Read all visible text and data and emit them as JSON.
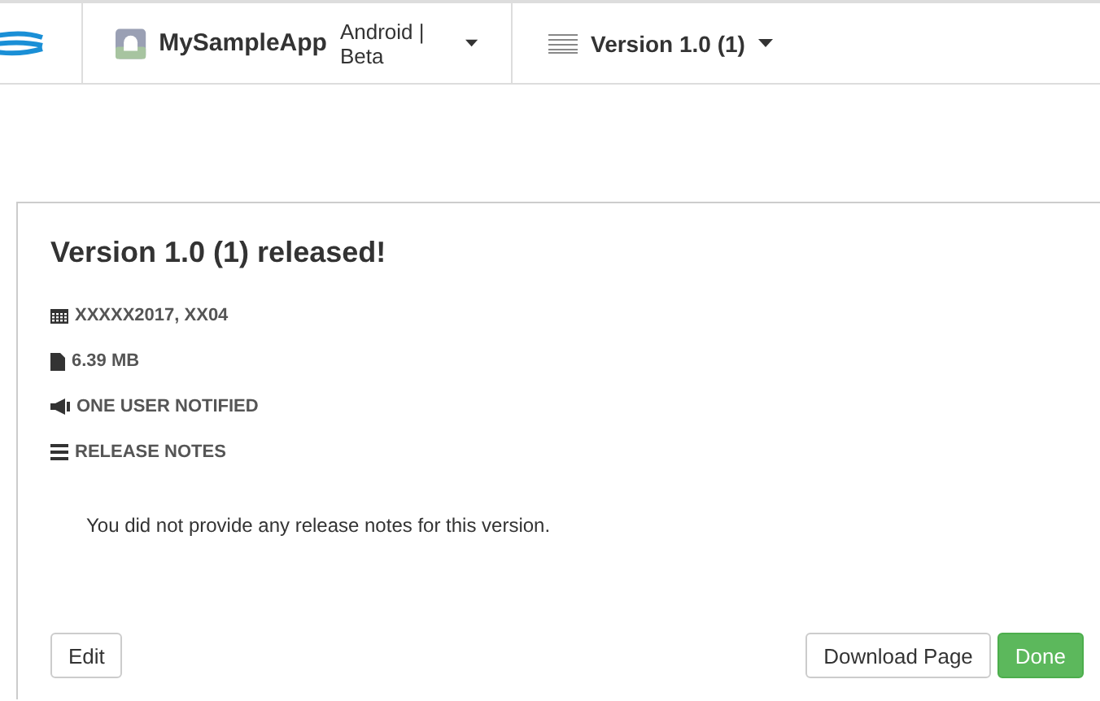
{
  "header": {
    "app_name": "MySampleApp",
    "app_platform": "Android | Beta",
    "version": "Version 1.0 (1)"
  },
  "release": {
    "title": "Version 1.0 (1) released!",
    "meta": [
      {
        "kind": "date",
        "text": "XXXXX2017, XX04"
      },
      {
        "kind": "size",
        "text": "6.39 MB"
      },
      {
        "kind": "notified",
        "text": "ONE USER NOTIFIED"
      },
      {
        "kind": "notes",
        "text": "RELEASE NOTES"
      }
    ],
    "notes_text": "You did not provide any release notes for this version.",
    "buttons": [
      {
        "label": "Edit",
        "kind": "default"
      },
      {
        "label": "Download Page",
        "kind": "default"
      },
      {
        "label": "Done",
        "kind": "primary"
      }
    ]
  }
}
